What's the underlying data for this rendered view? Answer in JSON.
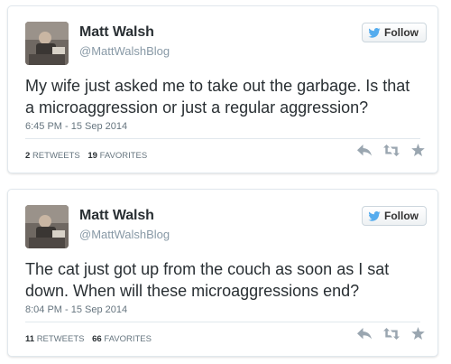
{
  "tweets": [
    {
      "name": "Matt Walsh",
      "handle": "@MattWalshBlog",
      "follow_label": "Follow",
      "text": "My wife just asked me to take out the garbage. Is that a microaggression or just a regular aggression?",
      "time": "6:45 PM - 15 Sep 2014",
      "retweets_count": "2",
      "retweets_label": "RETWEETS",
      "favorites_count": "19",
      "favorites_label": "FAVORITES"
    },
    {
      "name": "Matt Walsh",
      "handle": "@MattWalshBlog",
      "follow_label": "Follow",
      "text": "The cat just got up from the couch as soon as I sat down. When will these microaggressions end?",
      "time": "8:04 PM - 15 Sep 2014",
      "retweets_count": "11",
      "retweets_label": "RETWEETS",
      "favorites_count": "66",
      "favorites_label": "FAVORITES"
    }
  ],
  "icons": [
    "reply-icon",
    "retweet-icon",
    "favorite-icon",
    "twitter-bird-icon"
  ],
  "colors": {
    "text": "#292f33",
    "muted": "#8899a6",
    "border": "#e1e8ed",
    "bird": "#55acee",
    "action_icon": "#9aa6b0"
  }
}
